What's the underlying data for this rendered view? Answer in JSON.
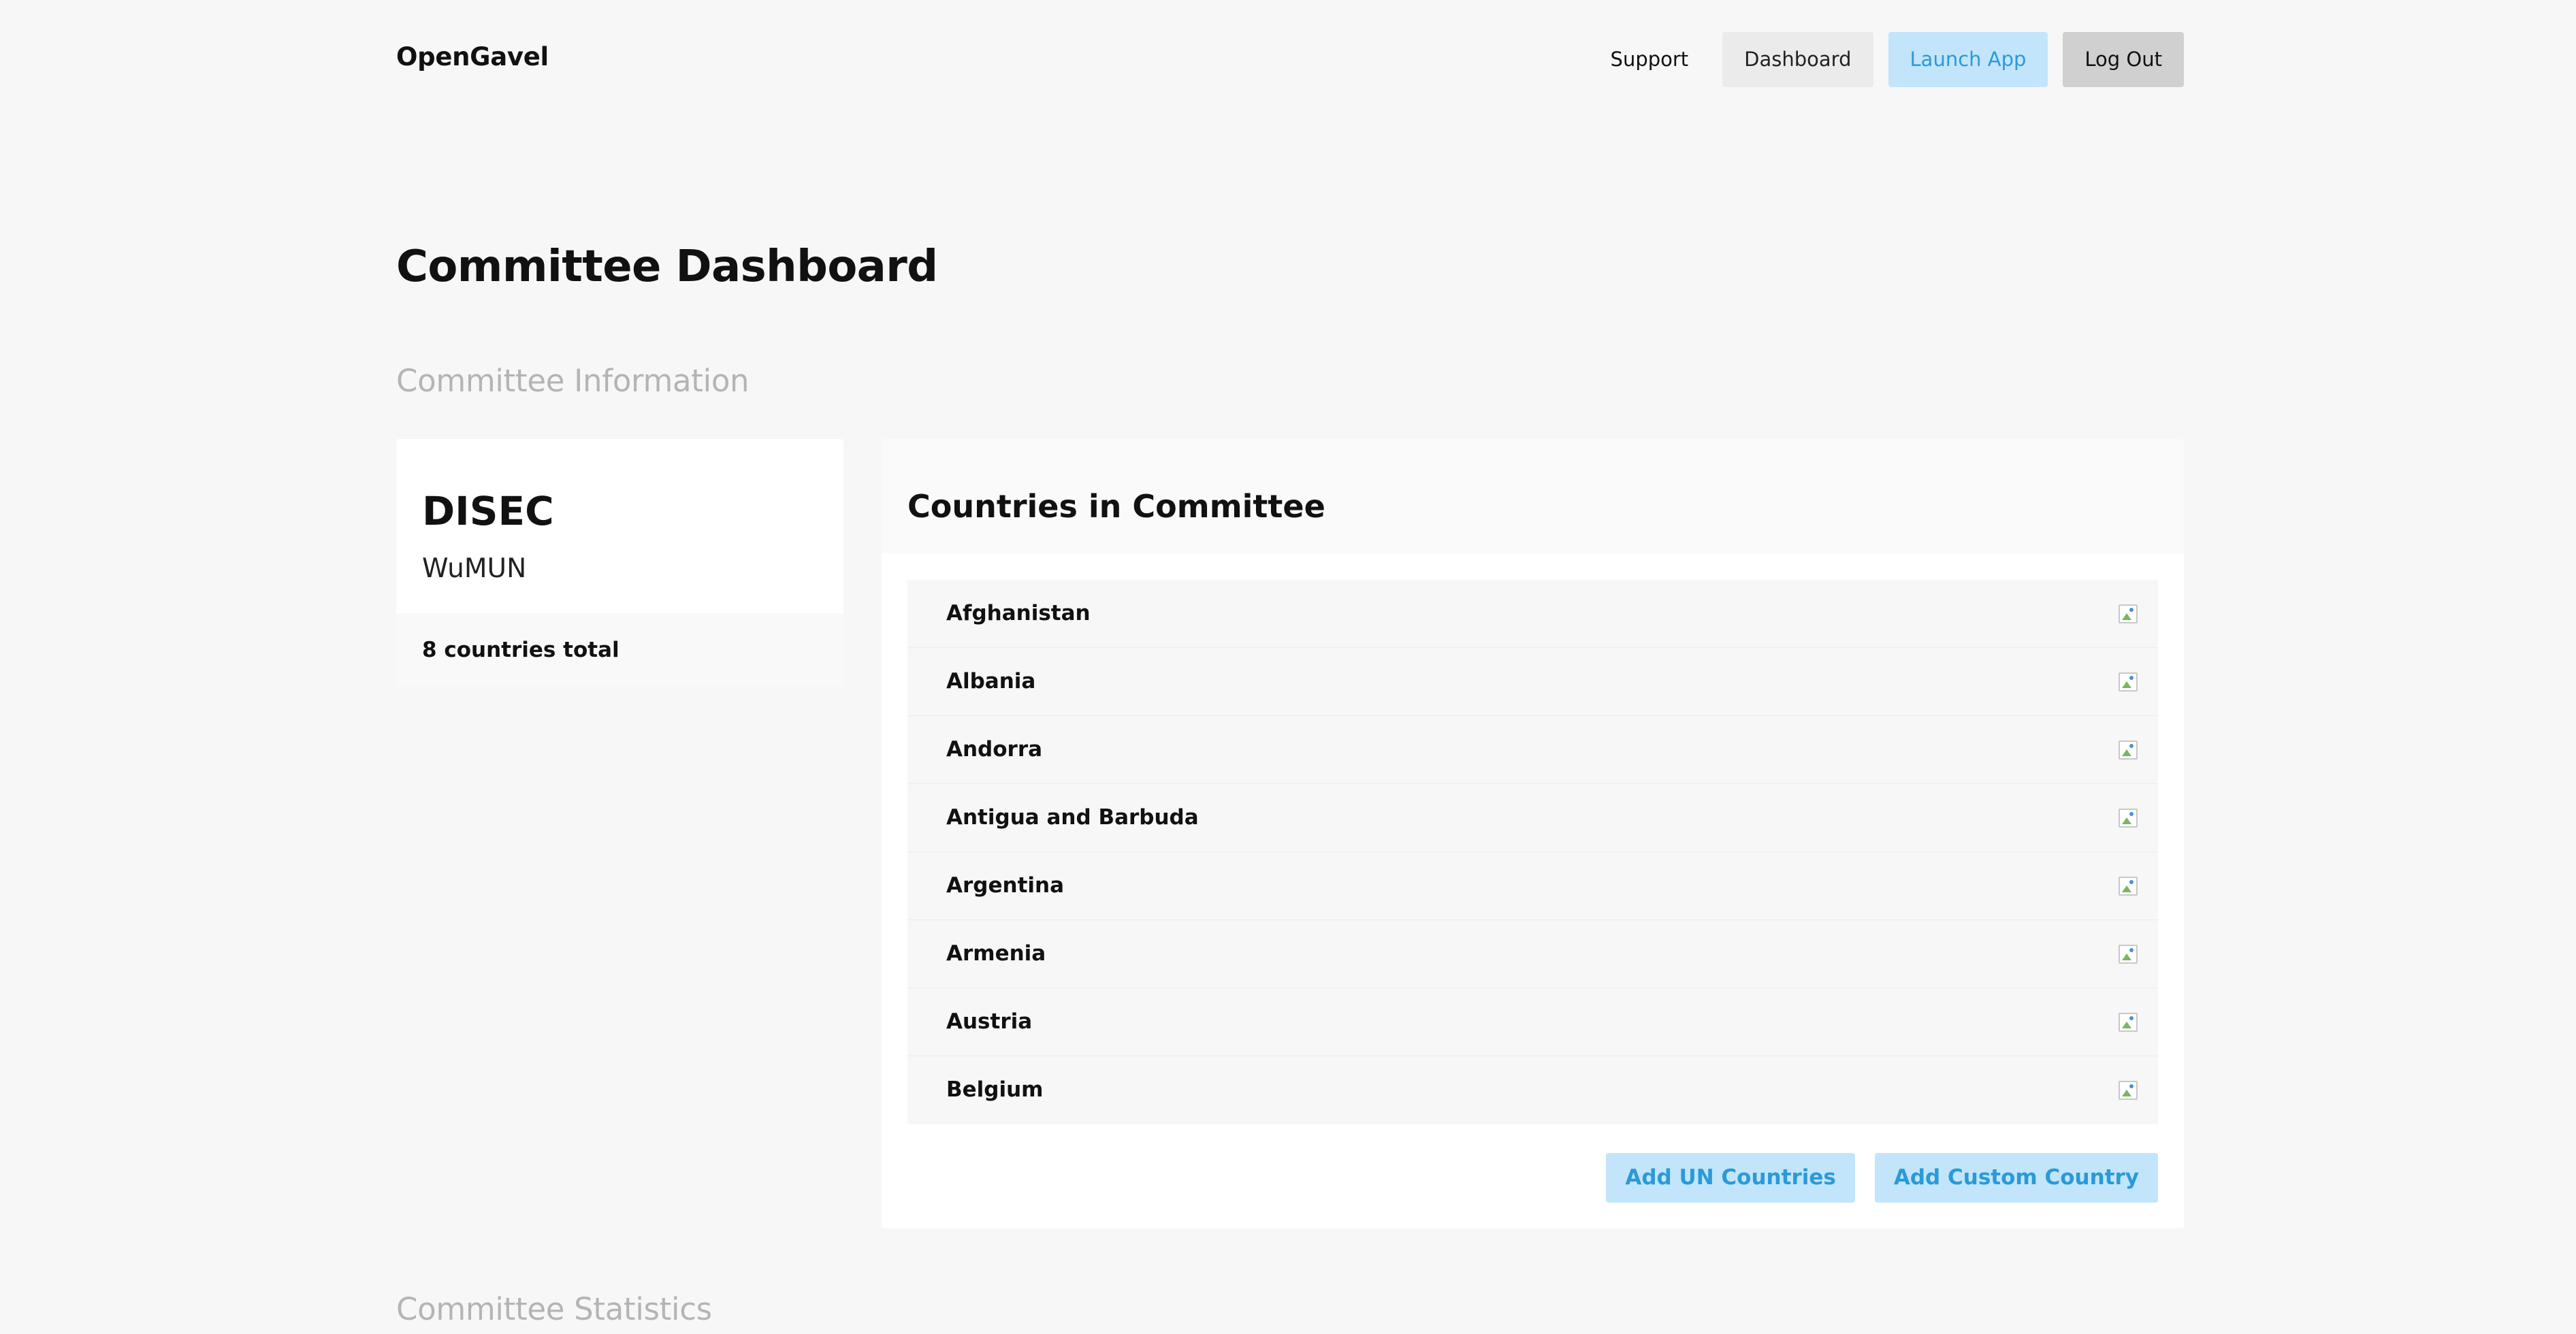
{
  "header": {
    "brand": "OpenGavel",
    "nav": {
      "support": "Support",
      "dashboard": "Dashboard",
      "launch_app": "Launch App",
      "log_out": "Log Out"
    }
  },
  "page": {
    "title": "Committee Dashboard",
    "section_info": "Committee Information",
    "section_stats": "Committee Statistics"
  },
  "committee": {
    "name": "DISEC",
    "conference": "WuMUN",
    "countries_total": "8 countries total"
  },
  "countries_card": {
    "title": "Countries in Committee",
    "countries": [
      {
        "name": "Afghanistan",
        "icon": "flag-image-icon"
      },
      {
        "name": "Albania",
        "icon": "flag-image-icon"
      },
      {
        "name": "Andorra",
        "icon": "flag-image-icon"
      },
      {
        "name": "Antigua and Barbuda",
        "icon": "flag-image-icon"
      },
      {
        "name": "Argentina",
        "icon": "flag-image-icon"
      },
      {
        "name": "Armenia",
        "icon": "flag-image-icon"
      },
      {
        "name": "Austria",
        "icon": "flag-image-icon"
      },
      {
        "name": "Belgium",
        "icon": "flag-image-icon"
      }
    ],
    "add_un_label": "Add UN Countries",
    "add_custom_label": "Add Custom Country"
  },
  "colors": {
    "background": "#f7f7f7",
    "accent_bg": "#c2e5fb",
    "accent_text": "#2a9ad8",
    "muted_heading": "#b4b4b4"
  }
}
